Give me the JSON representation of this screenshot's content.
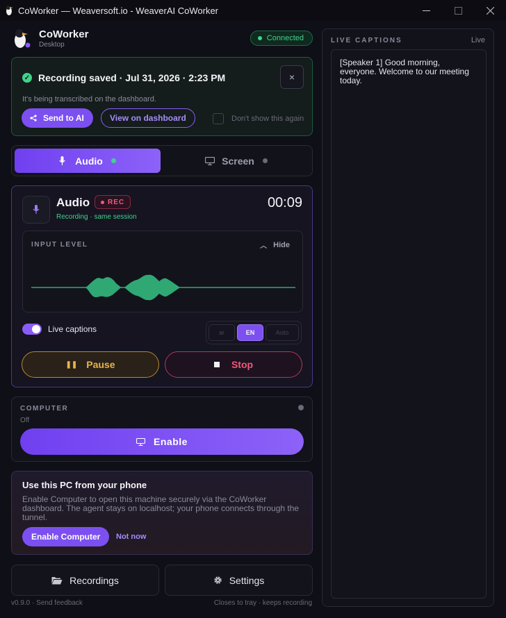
{
  "window": {
    "title": "CoWorker — Weaversoft.io - WeaverAI CoWorker",
    "minimize": "—",
    "maximize": "☐",
    "close": "✕"
  },
  "header": {
    "app_name": "CoWorker",
    "app_sub": "Desktop",
    "status": "Connected",
    "status_color": "#3fd48a"
  },
  "saved_banner": {
    "title": "Recording saved · Jul 31, 2026 · 2:23 PM",
    "description": "It's being transcribed on the dashboard.",
    "send_to_ai": "Send to AI",
    "view_dashboard": "View on dashboard",
    "dont_show": "Don't show this again",
    "close_icon": "×"
  },
  "modes": {
    "audio_label": "Audio",
    "screen_label": "Screen",
    "selected": "Audio"
  },
  "audio": {
    "title": "Audio",
    "rec_badge": "REC",
    "subtitle": "Recording · same session",
    "timer": "00:09",
    "input_level_label": "INPUT LEVEL",
    "hide_label": "Hide",
    "live_captions_label": "Live captions",
    "live_captions_on": true,
    "languages": [
      "ar",
      "EN",
      "Auto"
    ],
    "selected_language": "EN",
    "pause_label": "Pause",
    "stop_label": "Stop"
  },
  "computer": {
    "label": "COMPUTER",
    "status": "Off",
    "enable_label": "Enable"
  },
  "phone": {
    "title": "Use this PC from your phone",
    "description": "Enable Computer to open this machine securely via the CoWorker dashboard. The agent stays on localhost; your phone connects through the tunnel.",
    "enable_computer": "Enable Computer",
    "not_now": "Not now"
  },
  "bottom": {
    "recordings": "Recordings",
    "settings": "Settings"
  },
  "footer": {
    "version": "v0.9.0",
    "separator": "·",
    "feedback": "Send feedback",
    "tray_note": "Closes to tray · keeps recording"
  },
  "live_captions": {
    "label": "LIVE CAPTIONS",
    "live": "Live",
    "text": "[Speaker 1] Good morning, everyone. Welcome to our meeting today."
  },
  "colors": {
    "accent": "#7c4ff0",
    "success": "#3fd48a",
    "warning": "#e8b34a",
    "danger": "#f05a7a",
    "background": "#0f0f17"
  }
}
